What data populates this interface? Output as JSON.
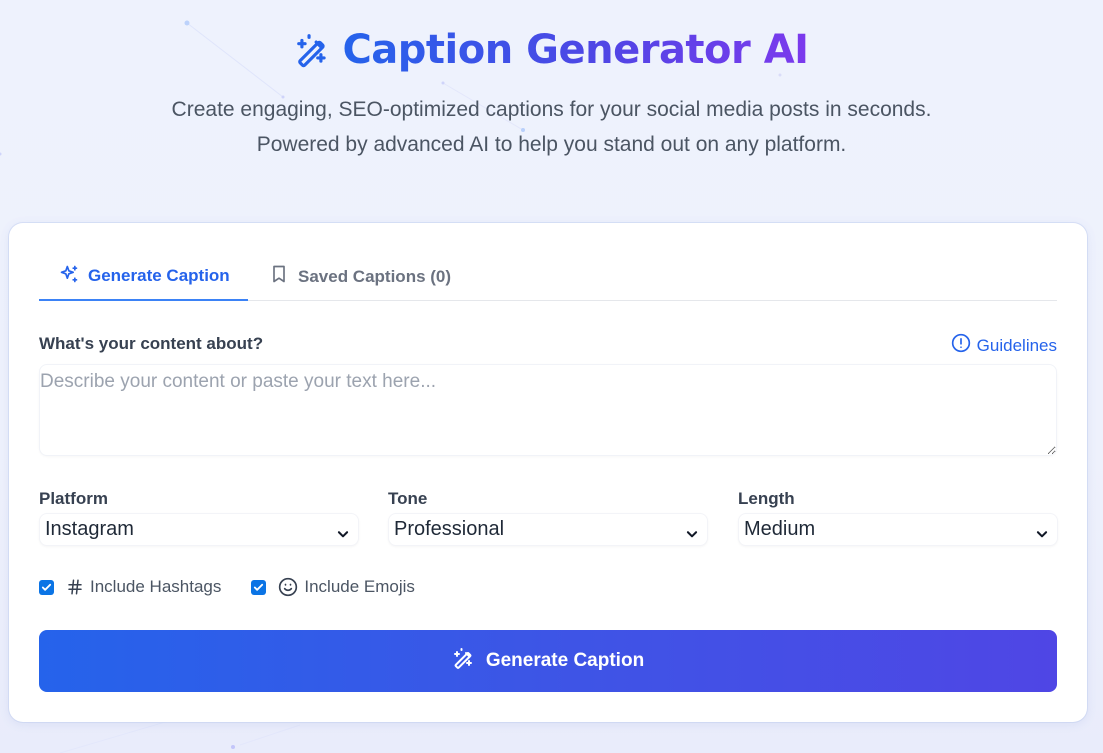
{
  "header": {
    "title": "Caption Generator AI",
    "title_icon": "magic-wand-icon",
    "subtitle_line1": "Create engaging, SEO-optimized captions for your social media posts in seconds.",
    "subtitle_line2": "Powered by advanced AI to help you stand out on any platform."
  },
  "colors": {
    "accent": "#2563eb",
    "accent_end": "#4f46e5",
    "title_gradient_end": "#7c3aed",
    "checkbox": "#0b74e5"
  },
  "tabs": [
    {
      "label": "Generate Caption",
      "icon": "sparkles-icon",
      "active": true
    },
    {
      "label": "Saved Captions (0)",
      "icon": "bookmark-icon",
      "active": false
    }
  ],
  "form": {
    "content_label": "What's your content about?",
    "guidelines_label": "Guidelines",
    "guidelines_icon": "alert-circle-icon",
    "content_value": "",
    "content_placeholder": "Describe your content or paste your text here...",
    "platform": {
      "label": "Platform",
      "value": "Instagram"
    },
    "tone": {
      "label": "Tone",
      "value": "Professional"
    },
    "length": {
      "label": "Length",
      "value": "Medium"
    },
    "include_hashtags": {
      "label": "Include Hashtags",
      "checked": true,
      "icon": "hash-icon"
    },
    "include_emojis": {
      "label": "Include Emojis",
      "checked": true,
      "icon": "smile-icon"
    },
    "generate_button": {
      "label": "Generate Caption",
      "icon": "magic-wand-icon"
    }
  }
}
